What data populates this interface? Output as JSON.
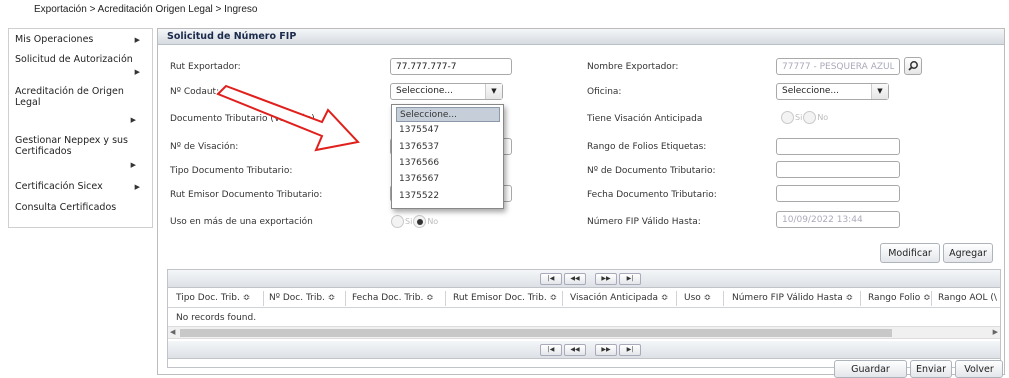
{
  "breadcrumb": "Exportación > Acreditación Origen Legal > Ingreso",
  "sidebar": {
    "items": [
      {
        "label": "Mis Operaciones"
      },
      {
        "label": "Solicitud de Autorización"
      },
      {
        "label": "Acreditación de Origen Legal"
      },
      {
        "label": "Gestionar Neppex y sus Certificados"
      },
      {
        "label": "Certificación Sicex"
      },
      {
        "label": "Consulta Certificados"
      }
    ]
  },
  "panel": {
    "title": "Solicitud de Número FIP"
  },
  "form": {
    "rut_exportador_label": "Rut Exportador:",
    "rut_exportador_value": "77.777.777-7",
    "nombre_exportador_label": "Nombre Exportador:",
    "nombre_exportador_value": "77777 - PESQUERA AZUL",
    "codaut_label": "Nº Codaut:",
    "codaut_value": "Seleccione...",
    "oficina_label": "Oficina:",
    "oficina_value": "Seleccione...",
    "doc_tributario_label": "Documento Tributario (Visación)",
    "tiene_visacion_label": "Tiene Visación Anticipada",
    "visacion_label": "Nº de Visación:",
    "rango_folios_label": "Rango de Folios Etiquetas:",
    "tipo_doc_label": "Tipo Documento Tributario:",
    "nro_doc_label": "Nº de Documento Tributario:",
    "rut_emisor_label": "Rut Emisor Documento Tributario:",
    "fecha_doc_label": "Fecha Documento Tributario:",
    "uso_label": "Uso en más de una exportación",
    "fip_valido_label": "Número FIP Válido Hasta:",
    "fip_valido_value": "10/09/2022 13:44",
    "radio_si": "Si",
    "radio_no": "No"
  },
  "dropdown": {
    "options": [
      "Seleccione...",
      "1375547",
      "1376537",
      "1376566",
      "1376567",
      "1375522"
    ]
  },
  "buttons": {
    "modificar": "Modificar",
    "agregar": "Agregar",
    "guardar": "Guardar",
    "enviar": "Enviar",
    "volver": "Volver"
  },
  "grid": {
    "columns": [
      "Tipo Doc. Trib. ≎",
      "Nº Doc. Trib. ≎",
      "Fecha Doc. Trib. ≎",
      "Rut Emisor Doc. Trib. ≎",
      "Visación Anticipada ≎",
      "Uso ≎",
      "Número FIP Válido Hasta ≎",
      "Rango Folio ≎",
      "Rango AOL (\\"
    ],
    "empty_text": "No records found.",
    "pager": [
      "|◀",
      "◀◀",
      "▶▶",
      "▶|"
    ]
  },
  "colors": {
    "annotation_arrow": "#e0201c",
    "header_text": "#1b2b4b"
  },
  "icons": {
    "search": "search-icon",
    "chevron": "chevron-right-icon",
    "dropdown": "chevron-down-icon"
  }
}
